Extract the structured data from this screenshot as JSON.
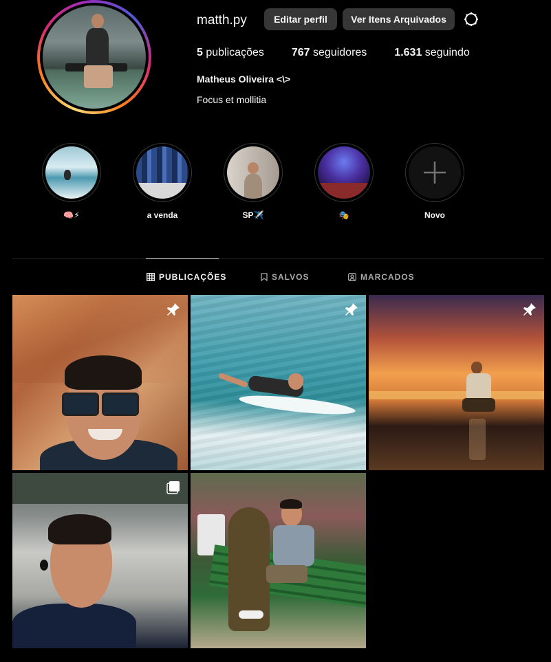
{
  "profile": {
    "username": "matth.py",
    "edit_button": "Editar perfil",
    "archive_button": "Ver Itens Arquivados",
    "stats": [
      {
        "count": "5",
        "label": "publicações"
      },
      {
        "count": "767",
        "label": "seguidores"
      },
      {
        "count": "1.631",
        "label": "seguindo"
      }
    ],
    "full_name": "Matheus Oliveira <\\>",
    "bio": "Focus et mollitia"
  },
  "highlights": [
    {
      "label": "🧠⚡"
    },
    {
      "label": "a venda"
    },
    {
      "label": "SP✈️"
    },
    {
      "label": "🎭"
    },
    {
      "label": "Novo"
    }
  ],
  "tabs": [
    {
      "label": "PUBLICAÇÕES",
      "icon": "grid-icon",
      "active": true
    },
    {
      "label": "SALVOS",
      "icon": "bookmark-icon",
      "active": false
    },
    {
      "label": "MARCADOS",
      "icon": "tagged-user-icon",
      "active": false
    }
  ],
  "posts": [
    {
      "badge": "pin-icon"
    },
    {
      "badge": "pin-icon"
    },
    {
      "badge": "pin-icon"
    },
    {
      "badge": "carousel-icon"
    },
    {
      "badge": ""
    }
  ],
  "colors": {
    "background": "#000000",
    "button": "#363636",
    "text": "#f5f5f5",
    "muted": "#a8a8a8",
    "divider": "#262626"
  }
}
